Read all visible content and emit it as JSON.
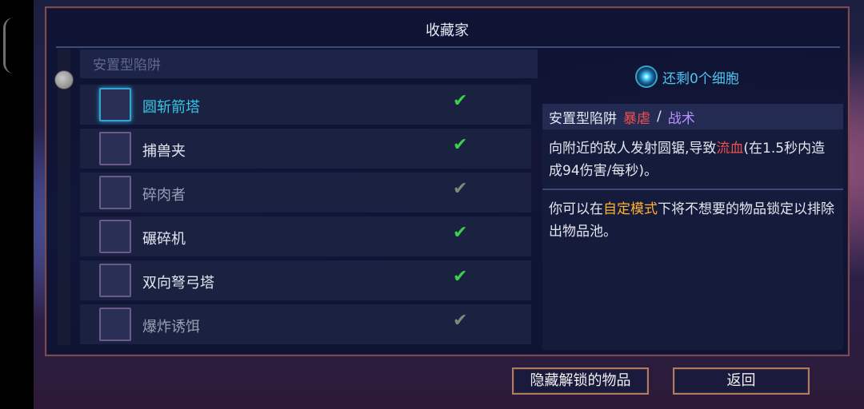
{
  "panel": {
    "title": "收藏家"
  },
  "category": {
    "header": "安置型陷阱"
  },
  "items": [
    {
      "label": "圆斩箭塔",
      "check": "✔"
    },
    {
      "label": "捕兽夹",
      "check": "✔"
    },
    {
      "label": "碎肉者",
      "check": "✔"
    },
    {
      "label": "碾碎机",
      "check": "✔"
    },
    {
      "label": "双向弩弓塔",
      "check": "✔"
    },
    {
      "label": "爆炸诱饵",
      "check": "✔"
    }
  ],
  "cells": {
    "text": "还剩0个细胞"
  },
  "details": {
    "type": "安置型陷阱",
    "tag1": "暴虐",
    "slash": "/",
    "tag2": "战术",
    "desc_part1": "向附近的敌人发射圆锯,导致",
    "desc_highlight": "流血",
    "desc_part2": "(在1.5秒内造成94伤害/每秒)。",
    "note_part1": "你可以在",
    "note_highlight": "自定模式",
    "note_part2": "下将不想要的物品锁定以排除出物品池。"
  },
  "buttons": {
    "hide_unlocked": "隐藏解锁的物品",
    "back": "返回"
  },
  "colors": {
    "tag_red": "#f0504e",
    "tag_purple": "#b890ff",
    "highlight_orange": "#ffb232",
    "selected_cyan": "#33c7e8"
  }
}
